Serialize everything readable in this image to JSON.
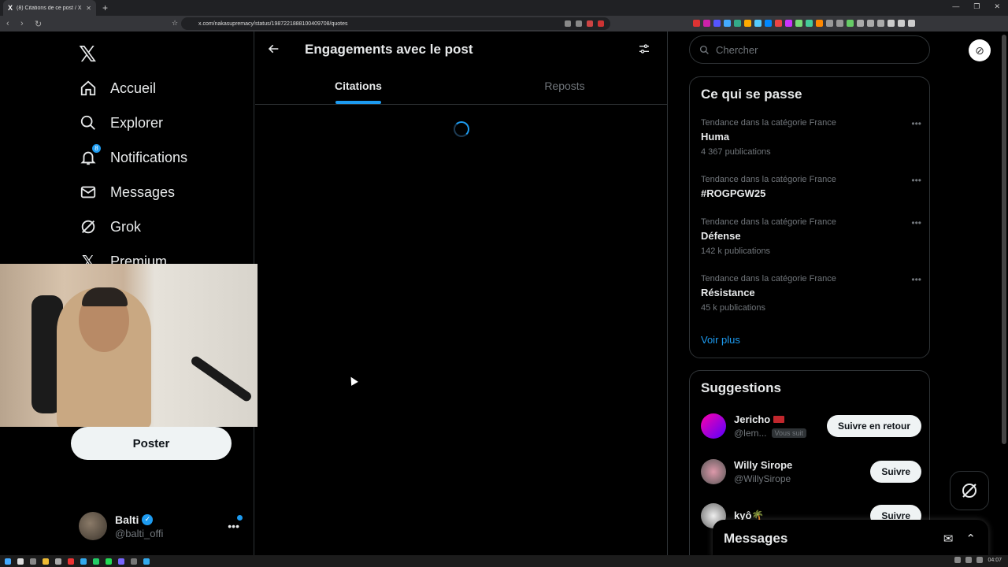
{
  "browser": {
    "tab_title": "(8) Citations de ce post / X",
    "tab_favicon": "X",
    "url": "x.com/nakasupremacy/status/1987221888100409708/quotes"
  },
  "sidebar": {
    "logo": "𝕏",
    "items": [
      {
        "label": "Accueil",
        "icon": "home-icon"
      },
      {
        "label": "Explorer",
        "icon": "search-icon"
      },
      {
        "label": "Notifications",
        "icon": "bell-icon",
        "badge": "8"
      },
      {
        "label": "Messages",
        "icon": "mail-icon"
      },
      {
        "label": "Grok",
        "icon": "grok-icon"
      },
      {
        "label": "Premium",
        "icon": "x-icon"
      }
    ],
    "post_button": "Poster",
    "profile": {
      "name": "Balti",
      "handle": "@balti_offi"
    }
  },
  "main": {
    "title": "Engagements avec le post",
    "tabs": [
      {
        "label": "Citations",
        "active": true
      },
      {
        "label": "Reposts",
        "active": false
      }
    ]
  },
  "right": {
    "search_placeholder": "Chercher",
    "trends_title": "Ce qui se passe",
    "trends": [
      {
        "category": "Tendance dans la catégorie France",
        "name": "Huma",
        "count": "4 367 publications"
      },
      {
        "category": "Tendance dans la catégorie France",
        "name": "#ROGPGW25",
        "count": ""
      },
      {
        "category": "Tendance dans la catégorie France",
        "name": "Défense",
        "count": "142 k publications"
      },
      {
        "category": "Tendance dans la catégorie France",
        "name": "Résistance",
        "count": "45 k publications"
      }
    ],
    "show_more": "Voir plus",
    "suggestions_title": "Suggestions",
    "suggestions": [
      {
        "name": "Jericho",
        "handle": "@lem...",
        "follows_you": "Vous suit",
        "button": "Suivre en retour"
      },
      {
        "name": "Willy Sirope",
        "handle": "@WillySirope",
        "follows_you": "",
        "button": "Suivre"
      },
      {
        "name": "kyô🌴",
        "handle": "",
        "follows_you": "",
        "button": "Suivre"
      }
    ],
    "messages_dock": "Messages"
  },
  "taskbar": {
    "time": "04:07"
  },
  "colors": {
    "accent": "#1d9bf0",
    "background": "#000000",
    "border": "#2f3336"
  }
}
